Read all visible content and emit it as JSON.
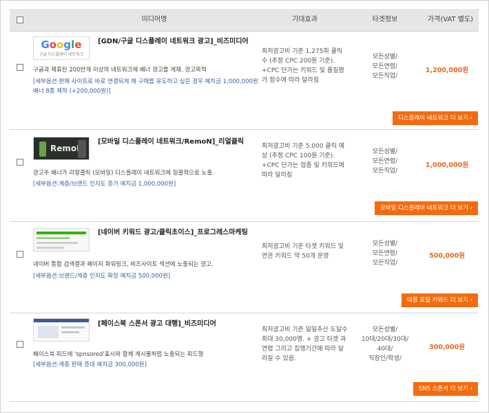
{
  "header": {
    "col_media": "미디어명",
    "col_effect": "기대효과",
    "col_target": "타겟정보",
    "col_price": "가격(VAT 별도)"
  },
  "rows": [
    {
      "thumb_text": "Google",
      "thumb_sub": "구글 디스플레이 네트워크",
      "title": "[GDN/구글 디스플레이 네트워크 광고]_비즈미디어",
      "desc": "구글과 제휴된 200만개 이상의 네트워크에 배너 광고를 게재. 광고목적",
      "option": "[세부옵션:판매 사이트로 바로 연결되게 해 구매를 유도하고 싶은 경우 예치금 1,000,000원 배너 8종 제작 (+200,000원)]",
      "effect": "최저광고비 기준 1,275회 클릭수 (추정 CPC 200원 기준). +CPC 단가는 키워드 및 품질평가 점수에 따라 달라짐",
      "target": [
        "모든성별/",
        "모든연령/",
        "모든직업/"
      ],
      "price": "1,200,000원",
      "more": "디스플레이 네트워크 더 보기"
    },
    {
      "thumb_text": "RemoN",
      "title": "[모바일 디스플레이 네트워크/RemoN]_리얼클릭",
      "desc": "광고주 배너가 리얼클릭 (모바일) 디스플레이 네트워크에 일괄적으로 노출.",
      "option": "[세부옵션:계층/브랜드 인지도 증가 예치금 1,000,000원]",
      "effect": "최저광고비 기준 5,000 클릭 예상 (추정 CPC 100원 기준). +CPC 단가는 업종 및 키워드에 따라 달라짐",
      "target": [
        "모든성별/",
        "모든연령/",
        "모든직업/"
      ],
      "price": "1,000,000원",
      "more": "모바일 디스플레이 네트워크 더 보기"
    },
    {
      "title": "[네이버 키워드 광고/클릭초이스]_프로그레스마케팅",
      "desc": "네이버 통합 검색결과 페이지 파워링크, 비즈사이트 섹션에 노출되는 광고.",
      "option": "[세부옵션:브랜드/계층 인지도 확장 예치금 500,000원]",
      "effect": "최저광고비 기준 타겟 키워드 및 연관 키워드 약 50개 운영",
      "target": [
        "모든성별/",
        "모든연령/",
        "모든직업/"
      ],
      "price": "500,000원",
      "more": "대형 포털 키워드 더 보기"
    },
    {
      "title": "[페이스북 스폰서 광고 대행]_비즈미디어",
      "desc": "페이스북 피드에 'spnsored'표시와 함께 게시물처럼 노출되는 피드형",
      "option": "[세부옵션:계층 판매 증대 예치금 300,000원]",
      "effect": "최저광고비 기준 일일추산 도달수 최대 30,000명. + 광고 타겟 과 연령 그리고 집행기간에 따라 달라질 수 있음.",
      "target": [
        "모든성별/",
        "10대/20대/30대/",
        "40대/",
        "직장인/학생/"
      ],
      "price": "300,000원",
      "more": "SNS 스폰서 더 보기"
    }
  ],
  "colors": {
    "accent": "#f46b0f",
    "price": "#e8671e",
    "option_text": "#3a5fa0"
  }
}
